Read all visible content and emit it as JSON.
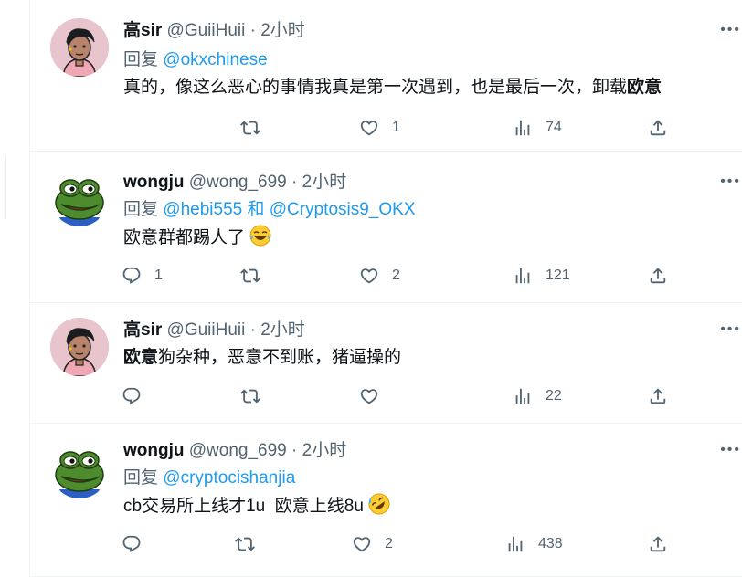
{
  "tweets": [
    {
      "name": "高sir",
      "handle": "@GuiiHuii",
      "dot": "·",
      "time": "2小时",
      "reply_prefix": "回复",
      "mentions": "@okxchinese",
      "text_plain": "真的，像这么恶心的事情我真是第一次遇到，也是最后一次，卸载",
      "text_bold": "欧意",
      "avatar": "man-avatar",
      "replies": "",
      "retweets": "",
      "likes": "1",
      "views": "74"
    },
    {
      "name": "wongju",
      "handle": "@wong_699",
      "dot": "·",
      "time": "2小时",
      "reply_prefix": "回复",
      "mentions": "@hebi555 和 @Cryptosis9_OKX",
      "text_plain": "欧意群都踢人了",
      "emoji": "joy-emoji",
      "avatar": "frog-avatar",
      "replies": "1",
      "retweets": "",
      "likes": "2",
      "views": "121"
    },
    {
      "name": "高sir",
      "handle": "@GuiiHuii",
      "dot": "·",
      "time": "2小时",
      "text_bold": "欧意",
      "text_plain": "狗杂种，恶意不到账，猪逼操的",
      "avatar": "man-avatar",
      "replies": "",
      "retweets": "",
      "likes": "",
      "views": "22"
    },
    {
      "name": "wongju",
      "handle": "@wong_699",
      "dot": "·",
      "time": "2小时",
      "reply_prefix": "回复",
      "mentions": "@cryptocishanjia",
      "text_plain": "cb交易所上线才1u  欧意上线8u",
      "emoji": "rofl-emoji",
      "avatar": "frog-avatar",
      "replies": "",
      "retweets": "",
      "likes": "2",
      "views": "438"
    }
  ],
  "icons": {
    "reply": "reply-icon",
    "retweet": "retweet-icon",
    "like": "heart-icon",
    "views": "views-icon",
    "share": "share-icon",
    "more": "more-icon"
  },
  "colors": {
    "text": "#0f1419",
    "secondary": "#536471",
    "link": "#1d9bf0",
    "border": "#eff3f4"
  }
}
